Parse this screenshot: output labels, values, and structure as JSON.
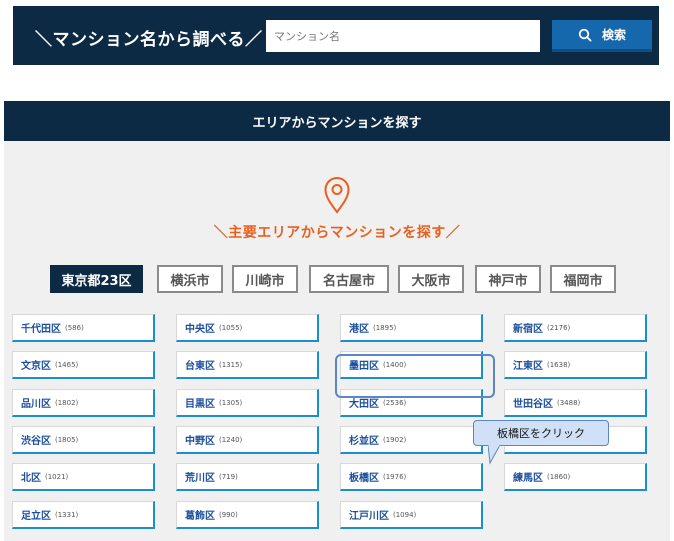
{
  "search_bar": {
    "title": "＼マンション名から調べる／",
    "placeholder": "マンション名",
    "button_label": "検索"
  },
  "area_section": {
    "header": "エリアからマンションを探す",
    "subtitle": "＼主要エリアからマンションを探す／",
    "cities": [
      {
        "label": "東京都23区",
        "active": true
      },
      {
        "label": "横浜市",
        "active": false
      },
      {
        "label": "川崎市",
        "active": false
      },
      {
        "label": "名古屋市",
        "active": false
      },
      {
        "label": "大阪市",
        "active": false
      },
      {
        "label": "神戸市",
        "active": false
      },
      {
        "label": "福岡市",
        "active": false
      }
    ],
    "wards": [
      {
        "name": "千代田区",
        "count": "(586)"
      },
      {
        "name": "中央区",
        "count": "(1055)"
      },
      {
        "name": "港区",
        "count": "(1895)"
      },
      {
        "name": "新宿区",
        "count": "(2176)"
      },
      {
        "name": "文京区",
        "count": "(1465)"
      },
      {
        "name": "台東区",
        "count": "(1315)"
      },
      {
        "name": "墨田区",
        "count": "(1400)"
      },
      {
        "name": "江東区",
        "count": "(1638)"
      },
      {
        "name": "品川区",
        "count": "(1802)"
      },
      {
        "name": "目黒区",
        "count": "(1305)"
      },
      {
        "name": "大田区",
        "count": "(2536)"
      },
      {
        "name": "世田谷区",
        "count": "(3488)"
      },
      {
        "name": "渋谷区",
        "count": "(1805)"
      },
      {
        "name": "中野区",
        "count": "(1240)"
      },
      {
        "name": "杉並区",
        "count": "(1902)"
      },
      {
        "name": "",
        "count": ""
      },
      {
        "name": "北区",
        "count": "(1021)"
      },
      {
        "name": "荒川区",
        "count": "(719)"
      },
      {
        "name": "板橋区",
        "count": "(1976)"
      },
      {
        "name": "練馬区",
        "count": "(1860)"
      },
      {
        "name": "足立区",
        "count": "(1331)"
      },
      {
        "name": "葛飾区",
        "count": "(990)"
      },
      {
        "name": "江戸川区",
        "count": "(1094)"
      }
    ]
  },
  "annotation": {
    "tooltip": "板橋区をクリック"
  },
  "colors": {
    "navy": "#0d2a45",
    "search_button": "#1668ad",
    "accent_orange": "#e8601e",
    "ward_text": "#1b4f9c",
    "ward_border": "#1a8ecf"
  }
}
